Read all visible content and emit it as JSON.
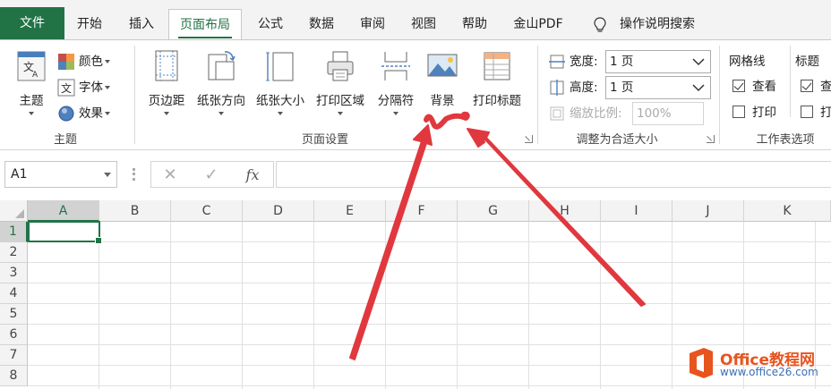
{
  "tabs": {
    "file": "文件",
    "items": [
      "开始",
      "插入",
      "页面布局",
      "公式",
      "数据",
      "审阅",
      "视图",
      "帮助",
      "金山PDF"
    ],
    "search": "操作说明搜索"
  },
  "theme_group": {
    "label": "主题",
    "theme_button": "主题",
    "colors": "颜色",
    "fonts": "字体",
    "effects": "效果"
  },
  "page_setup": {
    "label": "页面设置",
    "margins": "页边距",
    "orientation": "纸张方向",
    "size": "纸张大小",
    "print_area": "打印区域",
    "breaks": "分隔符",
    "background": "背景",
    "print_titles": "打印标题"
  },
  "scale_to_fit": {
    "label": "调整为合适大小",
    "width_label": "宽度:",
    "width_value": "1 页",
    "height_label": "高度:",
    "height_value": "1 页",
    "scale_label": "缩放比例:",
    "scale_value": "100%"
  },
  "sheet_options": {
    "label": "工作表选项",
    "gridlines": "网格线",
    "headings": "标题",
    "view": "查看",
    "print": "打印",
    "headings_view_clipped": "查",
    "headings_print_clipped": "打"
  },
  "formula_bar": {
    "name_box": "A1",
    "cancel": "✕",
    "enter": "✓",
    "fx": "fx"
  },
  "grid": {
    "columns": [
      "A",
      "B",
      "C",
      "D",
      "E",
      "F",
      "G",
      "H",
      "I",
      "J",
      "K"
    ],
    "rows": [
      "1",
      "2",
      "3",
      "4",
      "5",
      "6",
      "7",
      "8"
    ]
  },
  "watermark": {
    "name": "Office教程网",
    "url": "www.office26.com"
  },
  "colors": {
    "excel_green": "#217346",
    "annotation_red": "#e0383e",
    "watermark_orange": "#e8541e"
  }
}
